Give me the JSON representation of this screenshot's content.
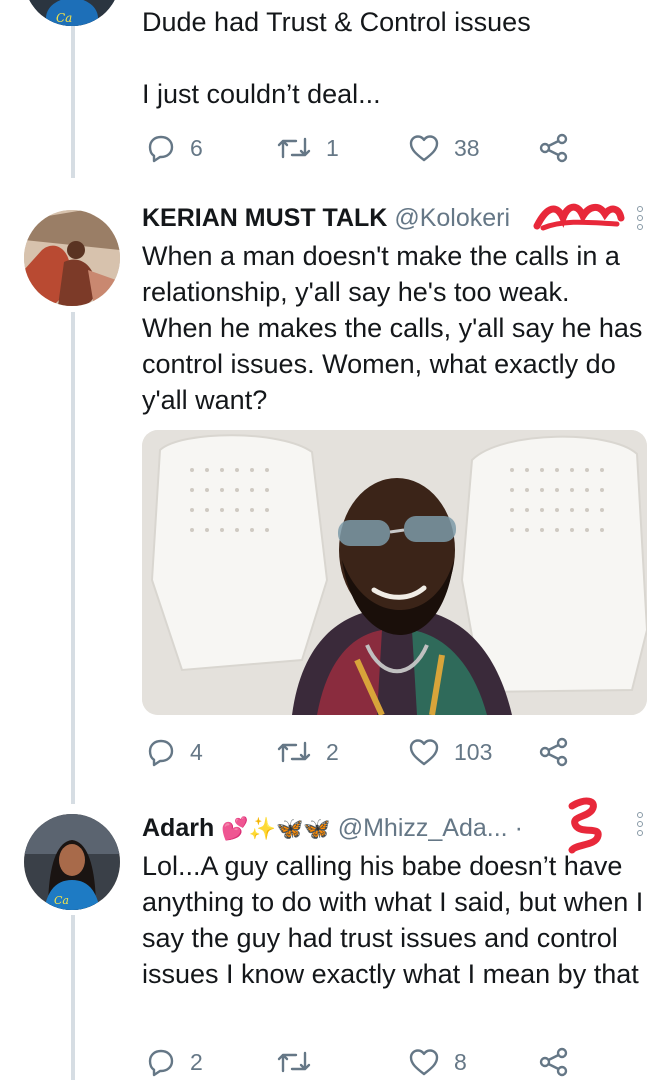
{
  "tweets": [
    {
      "text": "Dude had Trust & Control issues\n\nI just couldn’t deal...",
      "stats": {
        "replies": "6",
        "retweets": "1",
        "likes": "38"
      }
    },
    {
      "name": "KERIAN MUST TALK",
      "handle": "@Kolokeri",
      "text": "When a man doesn't make the calls in a relationship, y'all say he's too weak. When he makes the calls, y'all say he has control issues. Women, what exactly do y'all want?",
      "stats": {
        "replies": "4",
        "retweets": "2",
        "likes": "103"
      }
    },
    {
      "name": "Adarh",
      "emojis": "💕✨🦋🦋",
      "handle": "@Mhizz_Ada...",
      "separator": "·",
      "text": "Lol...A guy calling his babe doesn’t have anything to do with what I said, but when I say the guy had trust issues and control issues I know exactly what I mean by that",
      "stats": {
        "replies": "2",
        "retweets": "",
        "likes": "8"
      }
    }
  ],
  "colors": {
    "text": "#14171a",
    "muted": "#657786",
    "thread_line": "#d6dde3",
    "scribble": "#e8283a"
  }
}
